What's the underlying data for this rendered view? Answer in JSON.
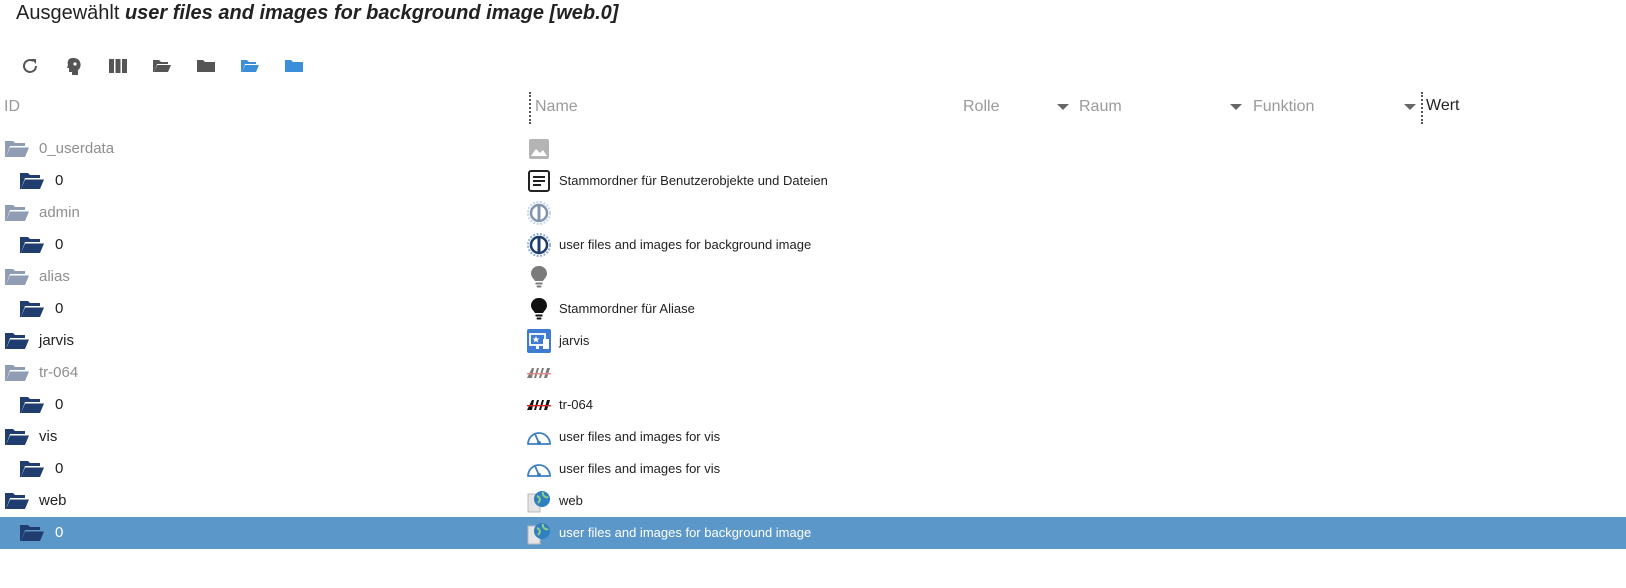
{
  "title": {
    "prefix": "Ausgewählt",
    "selected": "user files and images for background image [web.0]"
  },
  "toolbar": {
    "buttons": [
      {
        "icon": "refresh-icon"
      },
      {
        "icon": "head-profile-icon"
      },
      {
        "icon": "columns-icon"
      },
      {
        "icon": "folder-open-icon"
      },
      {
        "icon": "folder-closed-icon"
      },
      {
        "icon": "folder-open-blue-icon"
      },
      {
        "icon": "folder-blue-icon"
      }
    ]
  },
  "columns": {
    "id": "ID",
    "name": "Name",
    "role": "Rolle",
    "room": "Raum",
    "function": "Funktion",
    "value": "Wert"
  },
  "rows": [
    {
      "id": "0_userdata",
      "name": "",
      "icon": "image-icon",
      "level": 0,
      "dim": true,
      "folder": "open-light"
    },
    {
      "id": "0",
      "name": "Stammordner für Benutzerobjekte und Dateien",
      "icon": "document-icon",
      "level": 1,
      "dim": false,
      "folder": "open-dark"
    },
    {
      "id": "admin",
      "name": "",
      "icon": "admin-gear-icon",
      "level": 0,
      "dim": true,
      "folder": "open-light"
    },
    {
      "id": "0",
      "name": "user files and images for background image",
      "icon": "admin-gear-icon",
      "level": 1,
      "dim": false,
      "folder": "open-dark"
    },
    {
      "id": "alias",
      "name": "",
      "icon": "lightbulb-icon",
      "level": 0,
      "dim": true,
      "folder": "open-light"
    },
    {
      "id": "0",
      "name": "Stammordner für Aliase",
      "icon": "lightbulb-icon",
      "level": 1,
      "dim": false,
      "folder": "open-dark"
    },
    {
      "id": "jarvis",
      "name": "jarvis",
      "icon": "jarvis-monitor-icon",
      "level": 0,
      "dim": false,
      "folder": "open-dark"
    },
    {
      "id": "tr-064",
      "name": "",
      "icon": "avm-logo-icon",
      "level": 0,
      "dim": true,
      "folder": "open-light"
    },
    {
      "id": "0",
      "name": "tr-064",
      "icon": "avm-logo-icon",
      "level": 1,
      "dim": false,
      "folder": "open-dark"
    },
    {
      "id": "vis",
      "name": "user files and images for vis",
      "icon": "vis-gauge-icon",
      "level": 0,
      "dim": false,
      "folder": "open-dark"
    },
    {
      "id": "0",
      "name": "user files and images for vis",
      "icon": "vis-gauge-icon",
      "level": 1,
      "dim": false,
      "folder": "open-dark"
    },
    {
      "id": "web",
      "name": "web",
      "icon": "web-globe-icon",
      "level": 0,
      "dim": false,
      "folder": "open-dark"
    },
    {
      "id": "0",
      "name": "user files and images for background image",
      "icon": "web-globe-icon",
      "level": 1,
      "dim": false,
      "folder": "open-dark",
      "selected": true
    }
  ],
  "colors": {
    "selected_row": "#5b98c9",
    "folder_dark": "#1f3d6e",
    "folder_light": "#8f9cb3",
    "toolbar_blue": "#3b8fd9"
  }
}
